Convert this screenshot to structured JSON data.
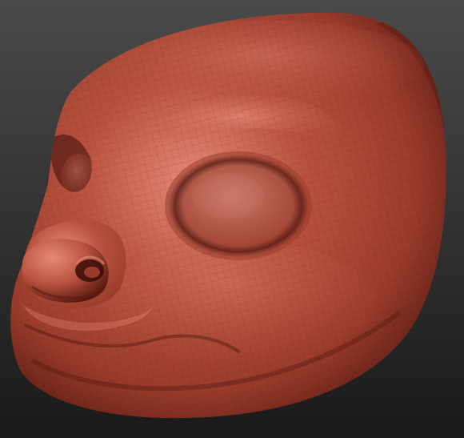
{
  "scene": {
    "subject": "sculpted-animal-head-mask",
    "colors": {
      "background_top": "#4a4a4a",
      "background_bottom": "#1a1a1a",
      "clay_highlight": "#e58a78",
      "clay_base": "#b8523f",
      "clay_mid": "#9a3c2c",
      "clay_shadow": "#5a1a12",
      "clay_deep": "#3a0d08",
      "eye_socket_fill": "#c87868",
      "wireframe": "#3f1208"
    }
  }
}
